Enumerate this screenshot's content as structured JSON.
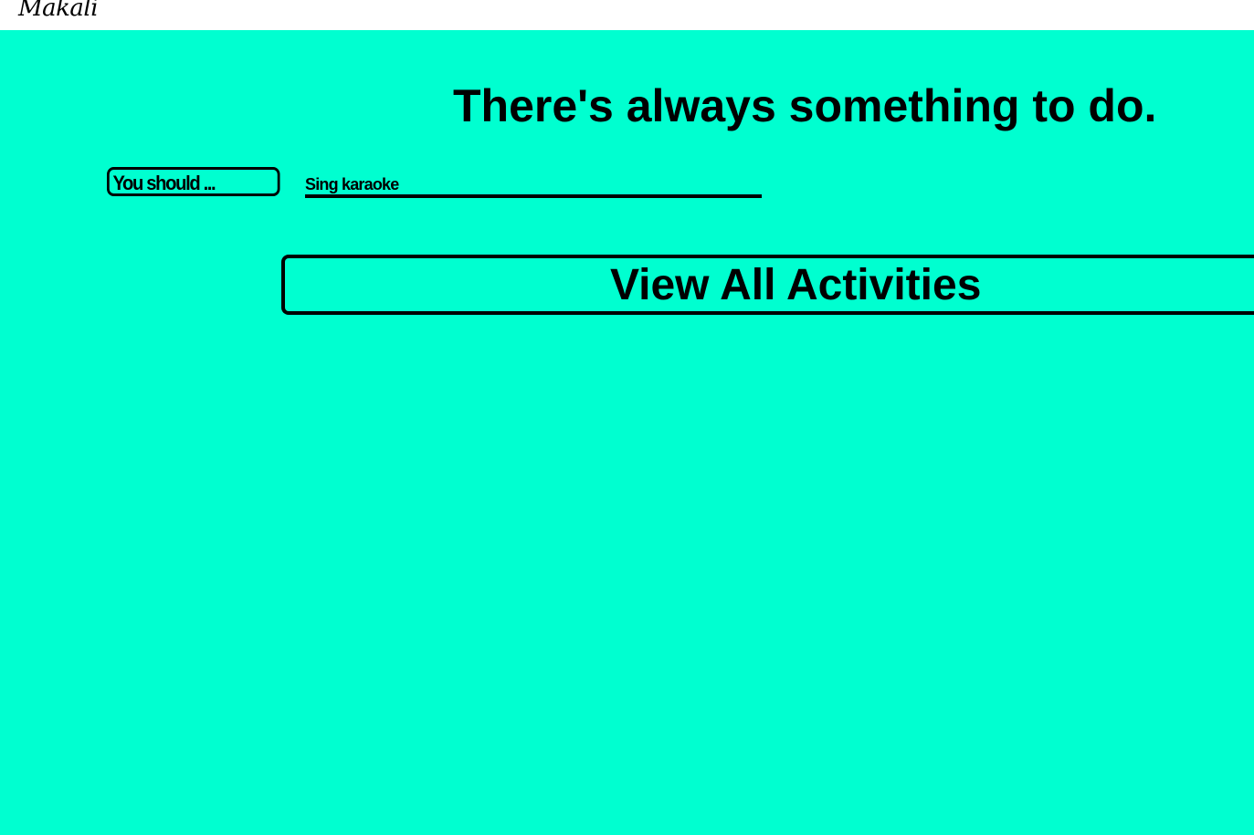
{
  "header": {
    "brand": "Makali"
  },
  "main": {
    "headline": "There's always something to do.",
    "should_label": "You should ...",
    "suggestion_value": "Sing karaoke",
    "view_all_label": "View All Activities"
  },
  "colors": {
    "background": "#00ffd0",
    "text": "#000000",
    "topbar": "#ffffff"
  }
}
